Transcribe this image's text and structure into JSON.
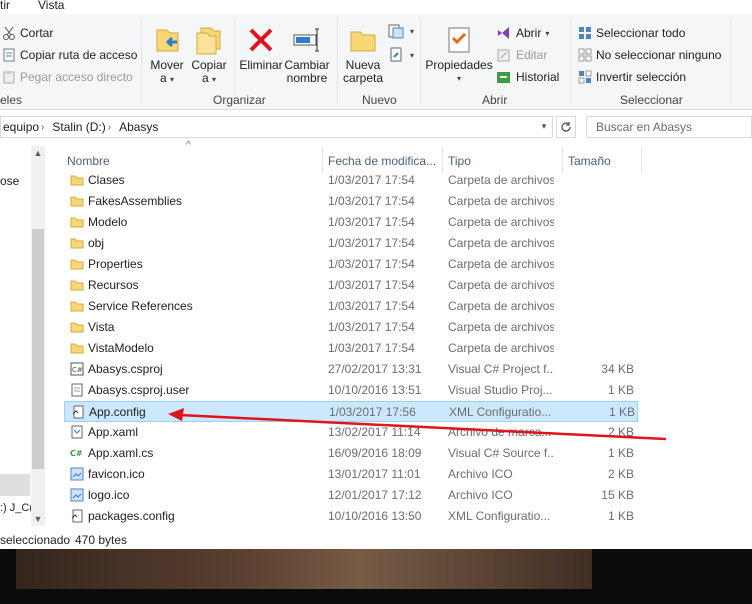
{
  "ribbon_tabs": {
    "t1": "tir",
    "t2": "Vista"
  },
  "clipboard": {
    "cut": "Cortar",
    "copy_path": "Copiar ruta de acceso",
    "paste_shortcut": "Pegar acceso directo",
    "group_label_fragment": "eles"
  },
  "organize": {
    "move_line1": "Mover",
    "move_line2": "a",
    "copy_line1": "Copiar",
    "copy_line2": "a",
    "delete_label": "Eliminar",
    "rename_line1": "Cambiar",
    "rename_line2": "nombre",
    "group_label": "Organizar"
  },
  "new_group": {
    "new_folder_line1": "Nueva",
    "new_folder_line2": "carpeta",
    "group_label": "Nuevo"
  },
  "open_group": {
    "properties_label": "Propiedades",
    "open_label": "Abrir",
    "edit_label": "Editar",
    "history_label": "Historial",
    "group_label": "Abrir"
  },
  "select_group": {
    "select_all": "Seleccionar todo",
    "select_none": "No seleccionar ninguno",
    "invert": "Invertir selección",
    "group_label": "Seleccionar"
  },
  "address": {
    "crumb1": "equipo",
    "crumb2": "Stalin (D:)",
    "crumb3": "Abasys",
    "search_placeholder": "Buscar en Abasys"
  },
  "nav_fragments": {
    "f1": "ose",
    "f2": "J_C("
  },
  "columns": {
    "name": "Nombre",
    "date": "Fecha de modifica...",
    "type": "Tipo",
    "size": "Tamaño"
  },
  "files": [
    {
      "name": "Clases",
      "date": "1/03/2017 17:54",
      "type": "Carpeta de archivos",
      "size": "",
      "icon": "folder"
    },
    {
      "name": "FakesAssemblies",
      "date": "1/03/2017 17:54",
      "type": "Carpeta de archivos",
      "size": "",
      "icon": "folder"
    },
    {
      "name": "Modelo",
      "date": "1/03/2017 17:54",
      "type": "Carpeta de archivos",
      "size": "",
      "icon": "folder"
    },
    {
      "name": "obj",
      "date": "1/03/2017 17:54",
      "type": "Carpeta de archivos",
      "size": "",
      "icon": "folder"
    },
    {
      "name": "Properties",
      "date": "1/03/2017 17:54",
      "type": "Carpeta de archivos",
      "size": "",
      "icon": "folder"
    },
    {
      "name": "Recursos",
      "date": "1/03/2017 17:54",
      "type": "Carpeta de archivos",
      "size": "",
      "icon": "folder"
    },
    {
      "name": "Service References",
      "date": "1/03/2017 17:54",
      "type": "Carpeta de archivos",
      "size": "",
      "icon": "folder"
    },
    {
      "name": "Vista",
      "date": "1/03/2017 17:54",
      "type": "Carpeta de archivos",
      "size": "",
      "icon": "folder"
    },
    {
      "name": "VistaModelo",
      "date": "1/03/2017 17:54",
      "type": "Carpeta de archivos",
      "size": "",
      "icon": "folder"
    },
    {
      "name": "Abasys.csproj",
      "date": "27/02/2017 13:31",
      "type": "Visual C# Project f...",
      "size": "34 KB",
      "icon": "csproj"
    },
    {
      "name": "Abasys.csproj.user",
      "date": "10/10/2016 13:51",
      "type": "Visual Studio Proj...",
      "size": "1 KB",
      "icon": "xmlfile"
    },
    {
      "name": "App.config",
      "date": "1/03/2017 17:56",
      "type": "XML Configuratio...",
      "size": "1 KB",
      "icon": "config"
    },
    {
      "name": "App.xaml",
      "date": "13/02/2017 11:14",
      "type": "Archivo de marca...",
      "size": "2 KB",
      "icon": "xaml"
    },
    {
      "name": "App.xaml.cs",
      "date": "16/09/2016 18:09",
      "type": "Visual C# Source f...",
      "size": "1 KB",
      "icon": "cs"
    },
    {
      "name": "favicon.ico",
      "date": "13/01/2017 11:01",
      "type": "Archivo ICO",
      "size": "2 KB",
      "icon": "image"
    },
    {
      "name": "logo.ico",
      "date": "12/01/2017 17:12",
      "type": "Archivo ICO",
      "size": "15 KB",
      "icon": "image"
    },
    {
      "name": "packages.config",
      "date": "10/10/2016 13:50",
      "type": "XML Configuratio...",
      "size": "1 KB",
      "icon": "config"
    }
  ],
  "selected_index": 11,
  "status": {
    "selected": "seleccionado",
    "size": "470 bytes"
  },
  "colors": {
    "selection_bg": "#cce8ff",
    "arrow": "#e0141b",
    "folder": "#f8d775"
  }
}
